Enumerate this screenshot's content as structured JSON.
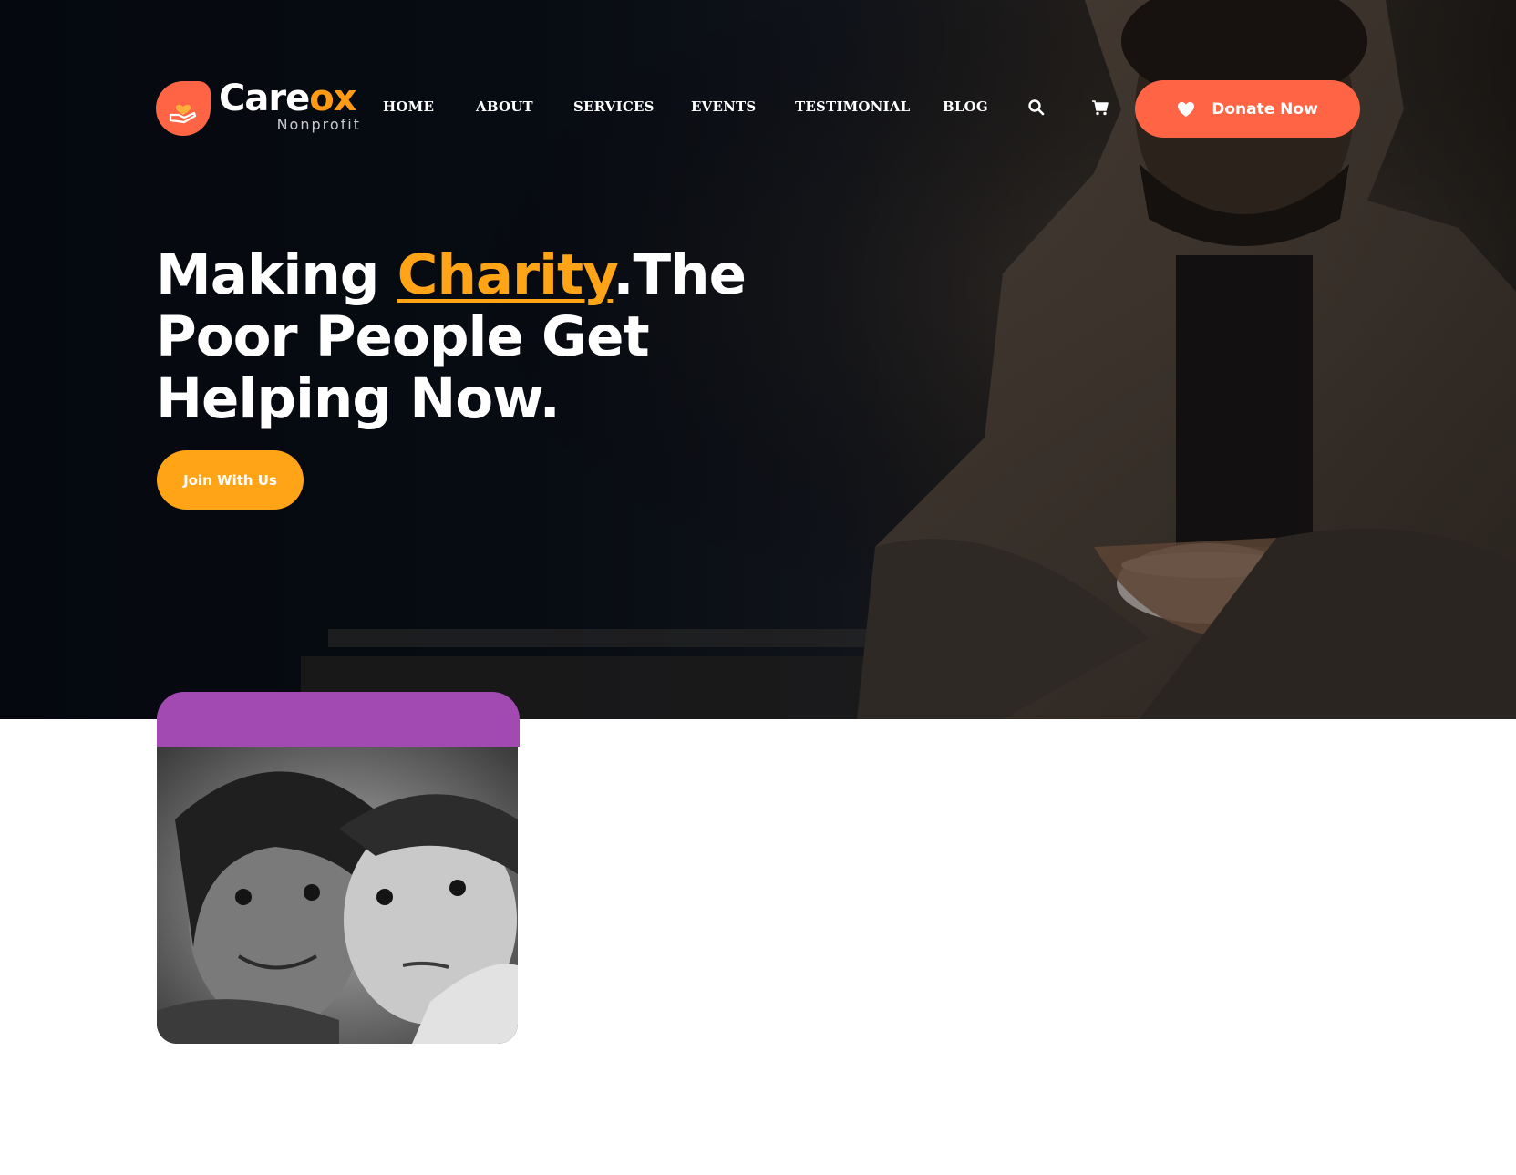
{
  "brand": {
    "name_main": "Care",
    "name_accent": "ox",
    "tagline": "Nonprofit",
    "primary_color": "#ff6544",
    "accent_color": "#ffa417",
    "card_color": "#a24ab1"
  },
  "nav": {
    "items": [
      {
        "label": "HOME"
      },
      {
        "label": "ABOUT"
      },
      {
        "label": "SERVICES"
      },
      {
        "label": "EVENTS"
      },
      {
        "label": "TESTIMONIAL"
      },
      {
        "label": "BLOG"
      }
    ],
    "search_icon": "search-icon",
    "cart_icon": "cart-icon",
    "donate_label": "Donate Now",
    "donate_icon": "heart-icon"
  },
  "hero": {
    "headline_before": "Making ",
    "headline_highlight": "Charity",
    "headline_after": ".The Poor People Get Helping Now.",
    "cta_label": "Join With Us"
  }
}
